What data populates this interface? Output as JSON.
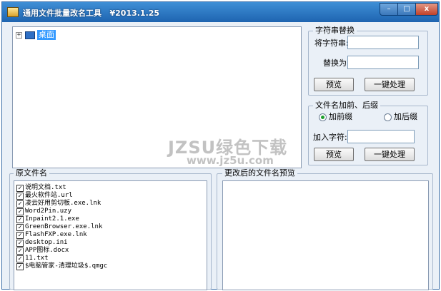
{
  "window": {
    "title": "通用文件批量改名工具   ¥2013.1.25",
    "min_label": "–",
    "max_label": "□",
    "close_label": "x"
  },
  "tree": {
    "expand_symbol": "+",
    "root_label": "桌面"
  },
  "replace_group": {
    "legend": "字符串替换",
    "find_label": "将字符串:",
    "find_value": "",
    "replace_label": "替换为:",
    "replace_value": "",
    "preview_button": "预览",
    "apply_button": "一键处理"
  },
  "affix_group": {
    "legend": "文件名加前、后缀",
    "prefix_label": "加前缀",
    "suffix_label": "加后缀",
    "selected": "prefix",
    "add_label": "加入字符:",
    "add_value": "",
    "preview_button": "预览",
    "apply_button": "一键处理"
  },
  "original_files": {
    "legend": "原文件名",
    "items": [
      {
        "name": "说明文档.txt",
        "checked": true
      },
      {
        "name": "最火软件站.url",
        "checked": true
      },
      {
        "name": "凌云好用剪切板.exe.lnk",
        "checked": true
      },
      {
        "name": "Word2Pin.uzy",
        "checked": true
      },
      {
        "name": "Inpaint2.1.exe",
        "checked": true
      },
      {
        "name": "GreenBrowser.exe.lnk",
        "checked": true
      },
      {
        "name": "FlashFXP.exe.lnk",
        "checked": true
      },
      {
        "name": "desktop.ini",
        "checked": true
      },
      {
        "name": "APP图标.docx",
        "checked": true
      },
      {
        "name": "11.txt",
        "checked": true
      },
      {
        "name": "$电脑管家-清理垃圾$.qmgc",
        "checked": true
      }
    ]
  },
  "preview_files": {
    "legend": "更改后的文件名预览"
  },
  "watermark": {
    "line1": "JZSU绿色下载",
    "line2": "www.jz5u.com"
  }
}
